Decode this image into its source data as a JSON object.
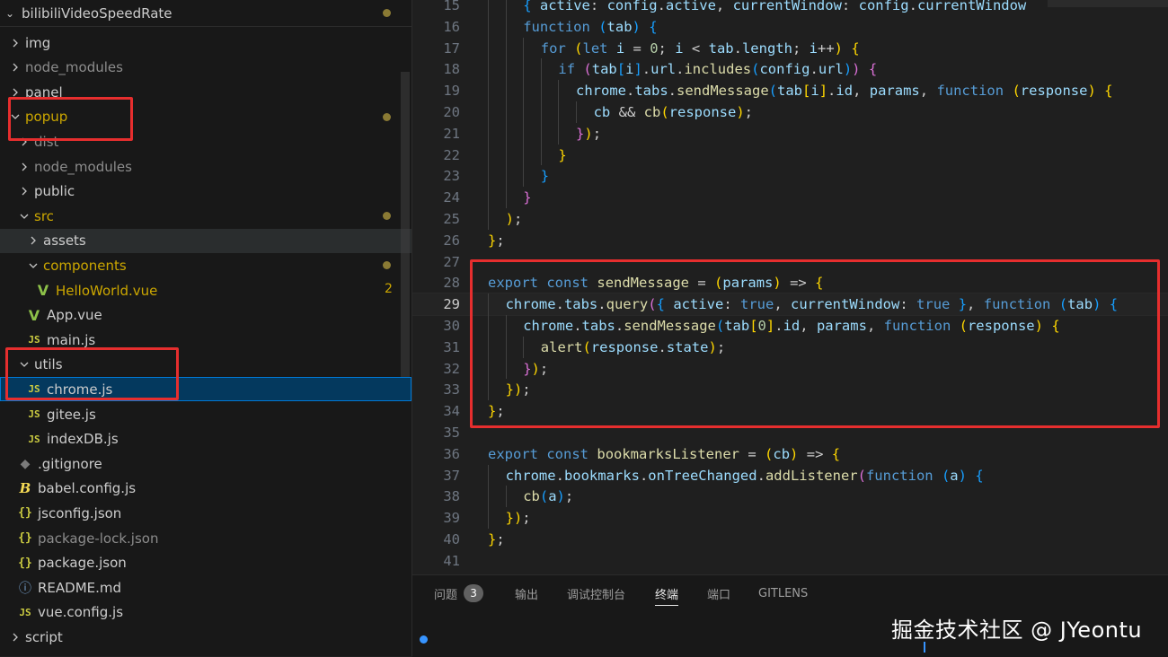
{
  "explorer": {
    "root": "bilibiliVideoSpeedRate",
    "items": [
      {
        "label": "img",
        "type": "folder",
        "open": false,
        "depth": 0
      },
      {
        "label": "node_modules",
        "type": "folder",
        "open": false,
        "depth": 0,
        "dim": true
      },
      {
        "label": "panel",
        "type": "folder",
        "open": false,
        "depth": 0
      },
      {
        "label": "popup",
        "type": "folder",
        "open": true,
        "depth": 0,
        "modified": true
      },
      {
        "label": "dist",
        "type": "folder",
        "open": false,
        "depth": 1,
        "dim": true
      },
      {
        "label": "node_modules",
        "type": "folder",
        "open": false,
        "depth": 1,
        "dim": true
      },
      {
        "label": "public",
        "type": "folder",
        "open": false,
        "depth": 1
      },
      {
        "label": "src",
        "type": "folder",
        "open": true,
        "depth": 1,
        "modified": true
      },
      {
        "label": "assets",
        "type": "folder",
        "open": false,
        "depth": 2
      },
      {
        "label": "components",
        "type": "folder",
        "open": true,
        "depth": 2,
        "modified": true
      },
      {
        "label": "HelloWorld.vue",
        "type": "vue",
        "depth": 3,
        "modified": true,
        "count": "2"
      },
      {
        "label": "App.vue",
        "type": "vue",
        "depth": 2
      },
      {
        "label": "main.js",
        "type": "js",
        "depth": 2
      },
      {
        "label": "utils",
        "type": "folder",
        "open": true,
        "depth": 1
      },
      {
        "label": "chrome.js",
        "type": "js",
        "depth": 2,
        "selected": true
      },
      {
        "label": "gitee.js",
        "type": "js",
        "depth": 2
      },
      {
        "label": "indexDB.js",
        "type": "js",
        "depth": 2
      },
      {
        "label": ".gitignore",
        "type": "git",
        "depth": 1
      },
      {
        "label": "babel.config.js",
        "type": "babel",
        "depth": 1
      },
      {
        "label": "jsconfig.json",
        "type": "json",
        "depth": 1
      },
      {
        "label": "package-lock.json",
        "type": "json",
        "depth": 1,
        "dim": true
      },
      {
        "label": "package.json",
        "type": "json",
        "depth": 1
      },
      {
        "label": "README.md",
        "type": "info",
        "depth": 1
      },
      {
        "label": "vue.config.js",
        "type": "js",
        "depth": 1
      },
      {
        "label": "script",
        "type": "folder",
        "open": false,
        "depth": 0
      }
    ]
  },
  "editor": {
    "current_line": 29,
    "lines": [
      {
        "n": 15,
        "depth": 2,
        "t": "{ active: config.active, currentWindow: config.currentWindow"
      },
      {
        "n": 16,
        "depth": 2,
        "t": "function (tab) {"
      },
      {
        "n": 17,
        "depth": 3,
        "t": "for (let i = 0; i < tab.length; i++) {"
      },
      {
        "n": 18,
        "depth": 4,
        "t": "if (tab[i].url.includes(config.url)) {"
      },
      {
        "n": 19,
        "depth": 5,
        "t": "chrome.tabs.sendMessage(tab[i].id, params, function (response) {"
      },
      {
        "n": 20,
        "depth": 6,
        "t": "cb && cb(response);"
      },
      {
        "n": 21,
        "depth": 5,
        "t": "});"
      },
      {
        "n": 22,
        "depth": 4,
        "t": "}"
      },
      {
        "n": 23,
        "depth": 3,
        "t": "}"
      },
      {
        "n": 24,
        "depth": 2,
        "t": "}"
      },
      {
        "n": 25,
        "depth": 1,
        "t": ");"
      },
      {
        "n": 26,
        "depth": 0,
        "t": "};"
      },
      {
        "n": 27,
        "depth": 0,
        "t": ""
      },
      {
        "n": 28,
        "depth": 0,
        "t": "export const sendMessage = (params) => {"
      },
      {
        "n": 29,
        "depth": 1,
        "t": "chrome.tabs.query({ active: true, currentWindow: true }, function (tab) {"
      },
      {
        "n": 30,
        "depth": 2,
        "t": "chrome.tabs.sendMessage(tab[0].id, params, function (response) {"
      },
      {
        "n": 31,
        "depth": 3,
        "t": "alert(response.state);"
      },
      {
        "n": 32,
        "depth": 2,
        "t": "});"
      },
      {
        "n": 33,
        "depth": 1,
        "t": "});"
      },
      {
        "n": 34,
        "depth": 0,
        "t": "};"
      },
      {
        "n": 35,
        "depth": 0,
        "t": ""
      },
      {
        "n": 36,
        "depth": 0,
        "t": "export const bookmarksListener = (cb) => {"
      },
      {
        "n": 37,
        "depth": 1,
        "t": "chrome.bookmarks.onTreeChanged.addListener(function (a) {"
      },
      {
        "n": 38,
        "depth": 2,
        "t": "cb(a);"
      },
      {
        "n": 39,
        "depth": 1,
        "t": "});"
      },
      {
        "n": 40,
        "depth": 0,
        "t": "};"
      },
      {
        "n": 41,
        "depth": 0,
        "t": ""
      }
    ]
  },
  "panel": {
    "tabs": [
      {
        "label": "问题",
        "badge": "3"
      },
      {
        "label": "输出"
      },
      {
        "label": "调试控制台"
      },
      {
        "label": "终端",
        "active": true
      },
      {
        "label": "端口"
      },
      {
        "label": "GITLENS"
      }
    ],
    "watermark": "掘金技术社区 @ JYeontu"
  },
  "colors": {
    "highlight": "#e62e2e",
    "selected_bg": "#04395e",
    "modified": "#cca700"
  }
}
